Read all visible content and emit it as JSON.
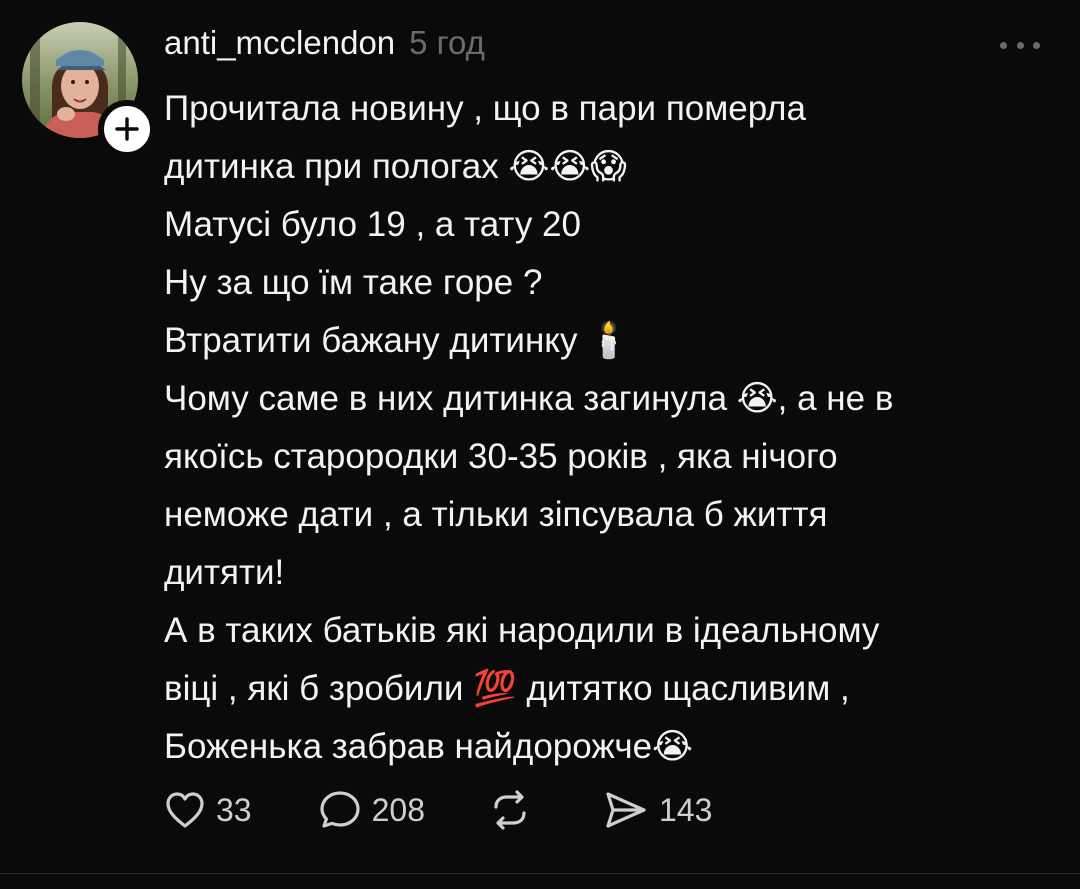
{
  "post": {
    "username": "anti_mcclendon",
    "time": "5 год",
    "lines": [
      "Прочитала новину , що в пари померла",
      "дитинка при пологах 😭😭😱",
      "Матусі було 19 , а тату 20",
      "Ну за що їм таке горе ?",
      "Втратити бажану дитинку 🕯️",
      "Чому саме в них дитинка загинула 😭, а не в",
      "якоїсь старородки 30-35 років , яка нічого",
      "неможе дати , а тільки зіпсувала б життя",
      "дитяти!",
      "А в таких батьків які народили в ідеальному",
      "віці , які б зробили 💯 дитятко щасливим ,",
      "Боженька забрав найдорожче😭"
    ],
    "likes": "33",
    "replies": "208",
    "reposts": "",
    "shares": "143"
  },
  "icons": {
    "more": "more-horizontal-icon",
    "follow": "plus-icon",
    "like": "heart-icon",
    "reply": "comment-bubble-icon",
    "repost": "repost-icon",
    "share": "send-icon"
  },
  "colors": {
    "background": "#0a0a0a",
    "text": "#f3f3f3",
    "muted": "#6b6b6b"
  }
}
